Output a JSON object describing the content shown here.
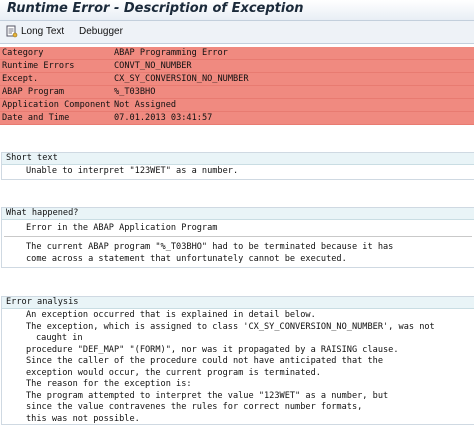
{
  "window": {
    "title": "Runtime Error - Description of Exception"
  },
  "toolbar": {
    "long_text": "Long Text",
    "debugger": "Debugger"
  },
  "header_fields": [
    {
      "label": "Category",
      "value": "ABAP Programming Error"
    },
    {
      "label": "Runtime Errors",
      "value": "CONVT_NO_NUMBER"
    },
    {
      "label": "Except.",
      "value": "CX_SY_CONVERSION_NO_NUMBER"
    },
    {
      "label": "ABAP Program",
      "value": "%_T03BHO"
    },
    {
      "label": "Application Component",
      "value": "Not Assigned"
    },
    {
      "label": "Date and Time",
      "value": "07.01.2013 03:41:57"
    }
  ],
  "short_text": {
    "heading": "Short text",
    "lines": [
      "Unable to interpret \"123WET\" as a number."
    ]
  },
  "what_happened": {
    "heading": "What happened?",
    "lines": [
      "Error in the ABAP Application Program",
      "The current ABAP program \"%_T03BHO\" had to be terminated because it has",
      "come across a statement that unfortunately cannot be executed."
    ]
  },
  "error_analysis": {
    "heading": "Error analysis",
    "lines": [
      "An exception occurred that is explained in detail below.",
      "The exception, which is assigned to class 'CX_SY_CONVERSION_NO_NUMBER', was not",
      "caught in",
      "procedure \"DEF_MAP\" \"(FORM)\", nor was it propagated by a RAISING clause.",
      "Since the caller of the procedure could not have anticipated that the",
      "exception would occur, the current program is terminated.",
      "The reason for the exception is:",
      "The program attempted to interpret the value \"123WET\" as a number, but",
      "since the value contravenes the rules for correct number formats,",
      "this was not possible."
    ]
  }
}
